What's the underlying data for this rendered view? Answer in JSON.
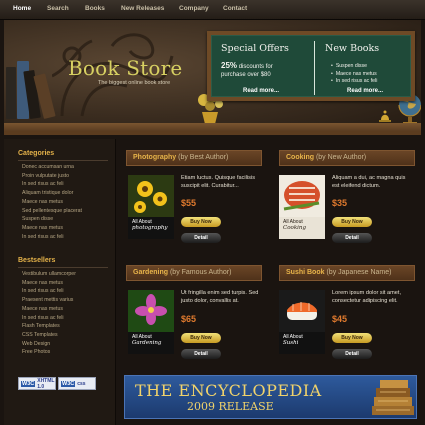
{
  "nav": {
    "items": [
      "Home",
      "Search",
      "Books",
      "New Releases",
      "Company",
      "Contact"
    ],
    "active": "Home"
  },
  "header": {
    "title": "Book Store",
    "tagline": "The biggest online book store"
  },
  "board": {
    "offers_title": "Special Offers",
    "offer_percent": "25%",
    "offer_text_1": "discounts for",
    "offer_text_2": "purchase over $80",
    "offers_more": "Read more...",
    "new_title": "New Books",
    "new_items": [
      "Suspen disse",
      "Maece nas metus",
      "In sed risus ac feli"
    ],
    "new_more": "Read more..."
  },
  "sidebar": {
    "categories_title": "Categories",
    "categories": [
      "Donec accumsan urna",
      "Proin vulputate justo",
      "In sed risus ac feli",
      "Aliquam tristique dolor",
      "Maece nas metus",
      "Sed pellentesque placerat",
      "Suspen disse",
      "Maece nas metus",
      "In sed risus ac feli"
    ],
    "bestsellers_title": "Bestsellers",
    "bestsellers": [
      "Vestibulum ullamcorper",
      "Maece nas metus",
      "In sed risus ac feli",
      "Praesent mettis varius",
      "Maece nas metus",
      "In sed risus ac feli",
      "Flash Templates",
      "CSS Templates",
      "Web Design",
      "Free Photos"
    ],
    "badges": [
      {
        "w3": "W3C",
        "label": "XHTML 1.0"
      },
      {
        "w3": "W3C",
        "label": "css"
      }
    ]
  },
  "products": [
    {
      "name": "Photography",
      "author": "(by Best Author)",
      "desc": "Etiam luctus. Quisque facilisis suscipit elit. Curabitur...",
      "price": "$55",
      "cover_label_1": "All About",
      "cover_label_2": "photography",
      "buy": "Buy Now",
      "detail": "Detail"
    },
    {
      "name": "Cooking",
      "author": "(by New Author)",
      "desc": "Aliquam a dui, ac magna quis est eleifend dictum.",
      "price": "$35",
      "cover_label_1": "All About",
      "cover_label_2": "Cooking",
      "buy": "Buy Now",
      "detail": "Detail"
    },
    {
      "name": "Gardening",
      "author": "(by Famous Author)",
      "desc": "Ut fringilla enim sed turpis. Sed justo dolor, convallis at.",
      "price": "$65",
      "cover_label_1": "All About",
      "cover_label_2": "Gardening",
      "buy": "Buy Now",
      "detail": "Detail"
    },
    {
      "name": "Sushi Book",
      "author": "(by Japanese Name)",
      "desc": "Lorem ipsum dolor sit amet, consectetur adipiscing elit.",
      "price": "$45",
      "cover_label_1": "All About",
      "cover_label_2": "Sushi",
      "buy": "Buy Now",
      "detail": "Detail"
    }
  ],
  "banner": {
    "line1": "THE ENCYCLOPEDIA",
    "line2": "2009 RELEASE"
  },
  "colors": {
    "accent": "#e4b24a",
    "price": "#e07a2e",
    "board": "#1f4a39",
    "brand": "#d7d062"
  }
}
